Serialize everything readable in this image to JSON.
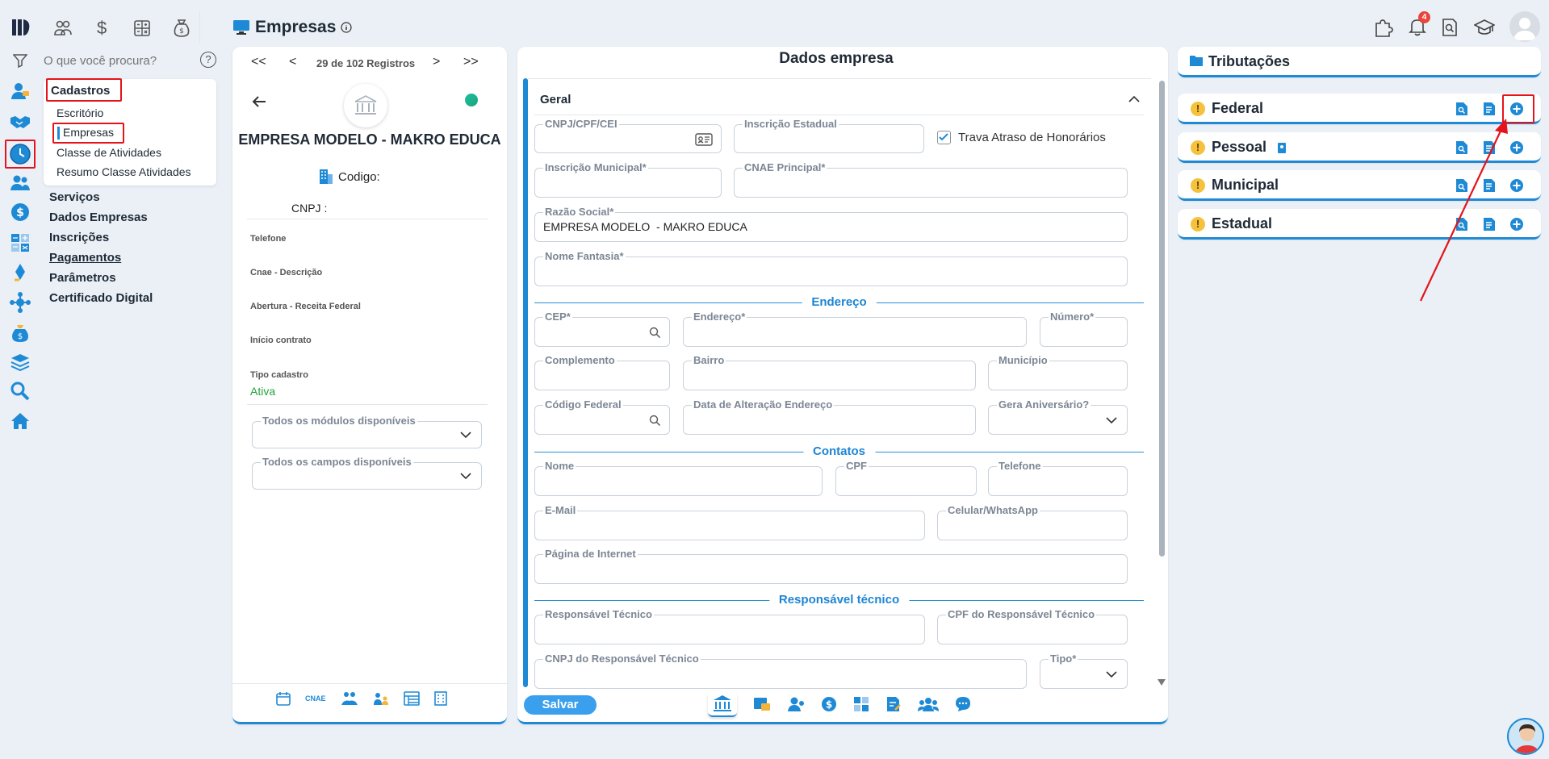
{
  "header": {
    "title": "Empresas",
    "notifications_count": "4"
  },
  "search": {
    "placeholder": "O que você procura?"
  },
  "menu": {
    "cadastros": "Cadastros",
    "sub": [
      "Escritório",
      "Empresas",
      "Classe de Atividades",
      "Resumo Classe Atividades"
    ],
    "items": [
      "Serviços",
      "Dados Empresas",
      "Inscrições",
      "Pagamentos",
      "Parâmetros",
      "Certificado Digital"
    ]
  },
  "record": {
    "nav_first": "<<",
    "nav_prev": "<",
    "counter": "29 de 102 Registros",
    "nav_next": ">",
    "nav_last": ">>",
    "company_name": "EMPRESA MODELO - MAKRO EDUCA",
    "codigo_label": "Codigo:",
    "cnpj_label": "CNPJ :",
    "telefone_label": "Telefone",
    "cnae_label": "Cnae - Descrição",
    "abertura_label": "Abertura - Receita Federal",
    "inicio_label": "Início contrato",
    "tipo_label": "Tipo cadastro",
    "tipo_value": "Ativa",
    "modulos_label": "Todos os módulos disponíveis",
    "campos_label": "Todos os campos disponíveis",
    "cnae_icon_text": "CNAE"
  },
  "form": {
    "title": "Dados empresa",
    "section_geral": "Geral",
    "cnpj": "CNPJ/CPF/CEI",
    "inscricao_estadual": "Inscrição Estadual",
    "trava": "Trava Atraso de Honorários",
    "inscricao_municipal": "Inscrição Municipal*",
    "cnae_principal": "CNAE Principal*",
    "razao_social": "Razão Social*",
    "razao_social_value": "EMPRESA MODELO  - MAKRO EDUCA",
    "nome_fantasia": "Nome Fantasia*",
    "section_endereco": "Endereço",
    "cep": "CEP*",
    "endereco": "Endereço*",
    "numero": "Número*",
    "complemento": "Complemento",
    "bairro": "Bairro",
    "municipio": "Município",
    "codigo_federal": "Código Federal",
    "data_alteracao": "Data de Alteração Endereço",
    "gera_aniversario": "Gera Aniversário?",
    "section_contatos": "Contatos",
    "nome": "Nome",
    "cpf": "CPF",
    "telefone": "Telefone",
    "email": "E-Mail",
    "celular": "Celular/WhatsApp",
    "pagina": "Página de Internet",
    "section_resp": "Responsável técnico",
    "resp_tecnico": "Responsável Técnico",
    "cpf_resp": "CPF do Responsável Técnico",
    "cnpj_resp": "CNPJ do Responsável Técnico",
    "tipo": "Tipo*",
    "save": "Salvar"
  },
  "tributacoes": {
    "title": "Tributações",
    "rows": [
      "Federal",
      "Pessoal",
      "Municipal",
      "Estadual"
    ]
  },
  "colors": {
    "accent": "#1e8ad6",
    "highlight": "#e3141b",
    "active": "#22a33a"
  }
}
